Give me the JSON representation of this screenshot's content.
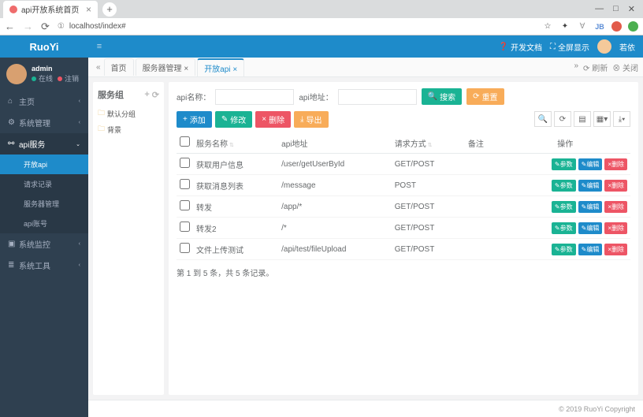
{
  "browser": {
    "tab_title": "api开放系统首页",
    "url": "localhost/index#",
    "url_prefix": "①",
    "jb": "JB"
  },
  "brand": "RuoYi",
  "nav_right": {
    "docs": "开发文档",
    "fullscreen": "全屏显示",
    "user": "若依"
  },
  "user": {
    "name": "admin",
    "online": "在线",
    "logout": "注销"
  },
  "menu": {
    "home": "主页",
    "sysmgmt": "系统管理",
    "apiservice": "api服务",
    "openapi": "开放api",
    "reqlog": "请求记录",
    "servermgmt": "服务器管理",
    "apiaccount": "api账号",
    "sysmonitor": "系统监控",
    "systool": "系统工具"
  },
  "tabs": {
    "home": "首页",
    "servermgmt": "服务器管理",
    "openapi": "开放api",
    "close": "关闭",
    "refresh": "刷新"
  },
  "tree": {
    "title": "服务组",
    "default_group": "默认分组",
    "search": "背景"
  },
  "search": {
    "name_label": "api名称：",
    "addr_label": "api地址：",
    "search_btn": "搜索",
    "reset_btn": "重置"
  },
  "toolbar": {
    "add": "添加",
    "modify": "修改",
    "delete": "删除",
    "export": "导出"
  },
  "columns": {
    "name": "服务名称",
    "addr": "api地址",
    "method": "请求方式",
    "remark": "备注",
    "op": "操作"
  },
  "rows": [
    {
      "name": "获取用户信息",
      "addr": "/user/getUserById",
      "method": "GET/POST",
      "remark": ""
    },
    {
      "name": "获取消息列表",
      "addr": "/message",
      "method": "POST",
      "remark": ""
    },
    {
      "name": "转发",
      "addr": "/app/*",
      "method": "GET/POST",
      "remark": ""
    },
    {
      "name": "转发2",
      "addr": "/*",
      "method": "GET/POST",
      "remark": ""
    },
    {
      "name": "文件上传测试",
      "addr": "/api/test/fileUpload",
      "method": "GET/POST",
      "remark": ""
    }
  ],
  "op_labels": {
    "params": "参数",
    "edit": "编辑",
    "delete": "删除"
  },
  "pager": "第 1 到 5 条，共 5 条记录。",
  "footer": "© 2019 RuoYi Copyright"
}
